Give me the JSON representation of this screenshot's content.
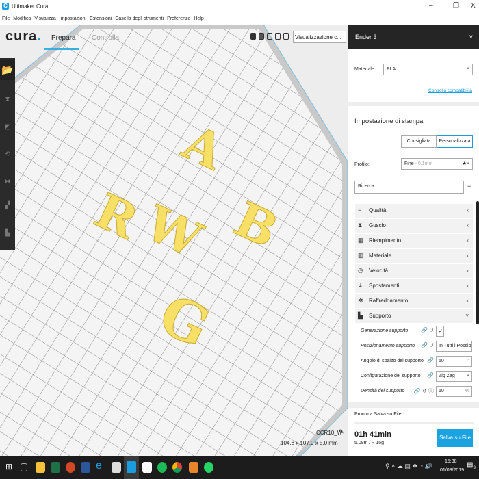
{
  "window": {
    "title": "Ultimaker Cura",
    "minimize": "–",
    "maximize": "❐",
    "close": "X"
  },
  "menu": [
    "File",
    "Modifica",
    "Visualizza",
    "Impostazioni",
    "Estensioni",
    "Casella degli strumenti",
    "Preferenze",
    "Help"
  ],
  "header": {
    "logo": "cura",
    "tabs": [
      {
        "label": "Prepara",
        "active": true
      },
      {
        "label": "Controlla",
        "active": false
      }
    ],
    "view_mode": "Visualizzazione c...",
    "accent": "#1a9de0"
  },
  "viewport": {
    "objects": [
      "A",
      "R",
      "W",
      "B",
      "G"
    ],
    "object_name": "CCR10_W",
    "dimensions": "104.8 x 107.0 x 5.0 mm"
  },
  "panel": {
    "machine": "Ender 3",
    "material_label": "Materiale",
    "material": "PLA",
    "compat_link": "Controlla compatibilità",
    "print_setup_title": "Impostazione di stampa",
    "mode_buttons": [
      "Consigliata",
      "Personalizzata"
    ],
    "profile_label": "Profilo:",
    "profile": "Fine",
    "profile_suffix": " - 0.1mm",
    "search_placeholder": "Ricerca...",
    "categories": [
      {
        "label": "Qualità",
        "icon": "≡"
      },
      {
        "label": "Guscio",
        "icon": "⧗"
      },
      {
        "label": "Riempimento",
        "icon": "▦"
      },
      {
        "label": "Materiale",
        "icon": "▥"
      },
      {
        "label": "Velocità",
        "icon": "◷"
      },
      {
        "label": "Spostamenti",
        "icon": "⇣"
      },
      {
        "label": "Raffreddamento",
        "icon": "✲"
      },
      {
        "label": "Supporto",
        "icon": "▙",
        "expanded": true
      }
    ],
    "support_settings": [
      {
        "label": "Generazione supporto",
        "value": "✓",
        "italic": true,
        "icons": "🔗 ↺"
      },
      {
        "label": "Posizionamento supporto",
        "value": "In Tutti i Possibi...",
        "italic": true,
        "icons": "🔗 ↺"
      },
      {
        "label": "Angolo di sbalzo del supporto",
        "value": "50",
        "unit": "°",
        "italic": false,
        "icons": "🔗"
      },
      {
        "label": "Configurazione del supporto",
        "value": "Zig Zag",
        "italic": false,
        "icons": "🔗"
      },
      {
        "label": "Densità del supporto",
        "value": "10",
        "unit": "%",
        "italic": true,
        "icons": "🔗 ↺ ⓘ"
      }
    ],
    "status": "Pronto a Salva su File",
    "time": "01h 41min",
    "material_usage": "5.08m / ~ 15g",
    "save_button": "Salva su File"
  },
  "taskbar": {
    "time": "15:38",
    "date": "01/08/2019",
    "notifications": "3"
  }
}
